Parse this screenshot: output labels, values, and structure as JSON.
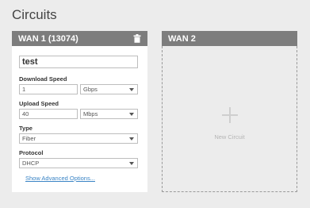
{
  "page": {
    "title": "Circuits"
  },
  "wan1": {
    "header": "WAN 1 (13074)",
    "name_value": "test",
    "download": {
      "label": "Download Speed",
      "value": "1",
      "unit": "Gbps"
    },
    "upload": {
      "label": "Upload Speed",
      "value": "40",
      "unit": "Mbps"
    },
    "type": {
      "label": "Type",
      "value": "Fiber"
    },
    "protocol": {
      "label": "Protocol",
      "value": "DHCP"
    },
    "advanced_link": "Show Advanced Options..."
  },
  "wan2": {
    "header": "WAN 2",
    "new_circuit_label": "New Circuit"
  },
  "icons": {
    "delete": "trash-icon",
    "add": "plus-icon",
    "dropdown": "chevron-down-icon"
  },
  "colors": {
    "header_bg": "#7d7d7d",
    "link": "#3a84c5",
    "page_bg": "#ececec"
  }
}
